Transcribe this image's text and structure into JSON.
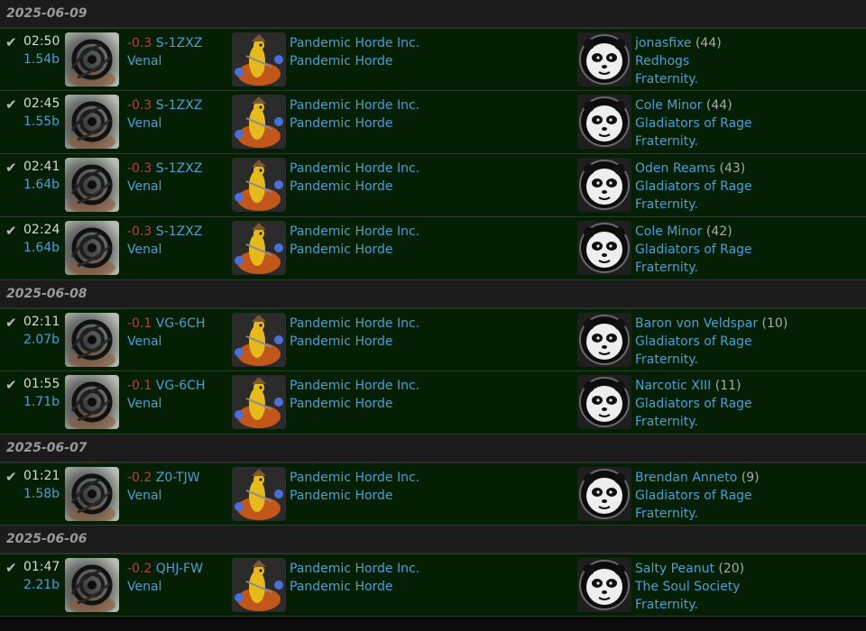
{
  "groups": [
    {
      "date": "2025-06-09",
      "kills": [
        {
          "time": "02:50",
          "value": "1.54b",
          "security": "-0.3",
          "system": "S-1ZXZ",
          "ship": "Venal",
          "att_corp": "Pandemic Horde Inc.",
          "att_alliance": "Pandemic Horde",
          "victim": "jonasfixe",
          "victim_count": "(44)",
          "victim_corp": "Redhogs",
          "victim_alliance": "Fraternity."
        },
        {
          "time": "02:45",
          "value": "1.55b",
          "security": "-0.3",
          "system": "S-1ZXZ",
          "ship": "Venal",
          "att_corp": "Pandemic Horde Inc.",
          "att_alliance": "Pandemic Horde",
          "victim": "Cole Minor",
          "victim_count": "(44)",
          "victim_corp": "Gladiators of Rage",
          "victim_alliance": "Fraternity."
        },
        {
          "time": "02:41",
          "value": "1.64b",
          "security": "-0.3",
          "system": "S-1ZXZ",
          "ship": "Venal",
          "att_corp": "Pandemic Horde Inc.",
          "att_alliance": "Pandemic Horde",
          "victim": "Oden Reams",
          "victim_count": "(43)",
          "victim_corp": "Gladiators of Rage",
          "victim_alliance": "Fraternity."
        },
        {
          "time": "02:24",
          "value": "1.64b",
          "security": "-0.3",
          "system": "S-1ZXZ",
          "ship": "Venal",
          "att_corp": "Pandemic Horde Inc.",
          "att_alliance": "Pandemic Horde",
          "victim": "Cole Minor",
          "victim_count": "(42)",
          "victim_corp": "Gladiators of Rage",
          "victim_alliance": "Fraternity."
        }
      ]
    },
    {
      "date": "2025-06-08",
      "kills": [
        {
          "time": "02:11",
          "value": "2.07b",
          "security": "-0.1",
          "system": "VG-6CH",
          "ship": "Venal",
          "att_corp": "Pandemic Horde Inc.",
          "att_alliance": "Pandemic Horde",
          "victim": "Baron von Veldspar",
          "victim_count": "(10)",
          "victim_corp": "Gladiators of Rage",
          "victim_alliance": "Fraternity."
        },
        {
          "time": "01:55",
          "value": "1.71b",
          "security": "-0.1",
          "system": "VG-6CH",
          "ship": "Venal",
          "att_corp": "Pandemic Horde Inc.",
          "att_alliance": "Pandemic Horde",
          "victim": "Narcotic XIII",
          "victim_count": "(11)",
          "victim_corp": "Gladiators of Rage",
          "victim_alliance": "Fraternity."
        }
      ]
    },
    {
      "date": "2025-06-07",
      "kills": [
        {
          "time": "01:21",
          "value": "1.58b",
          "security": "-0.2",
          "system": "Z0-TJW",
          "ship": "Venal",
          "att_corp": "Pandemic Horde Inc.",
          "att_alliance": "Pandemic Horde",
          "victim": "Brendan Anneto",
          "victim_count": "(9)",
          "victim_corp": "Gladiators of Rage",
          "victim_alliance": "Fraternity."
        }
      ]
    },
    {
      "date": "2025-06-06",
      "kills": [
        {
          "time": "01:47",
          "value": "2.21b",
          "security": "-0.2",
          "system": "QHJ-FW",
          "ship": "Venal",
          "att_corp": "Pandemic Horde Inc.",
          "att_alliance": "Pandemic Horde",
          "victim": "Salty Peanut",
          "victim_count": "(20)",
          "victim_corp": "The Soul Society",
          "victim_alliance": "Fraternity."
        }
      ]
    }
  ],
  "icons": {
    "status": "checkmark-icon",
    "ship": "venal-ship-icon",
    "attacker": "pandemic-horde-logo",
    "victim": "panda-logo"
  },
  "colors": {
    "link": "#4a9fd8",
    "security_negative": "#c23a3a",
    "row_background": "#041f04",
    "date_background": "#1b1b1b"
  }
}
